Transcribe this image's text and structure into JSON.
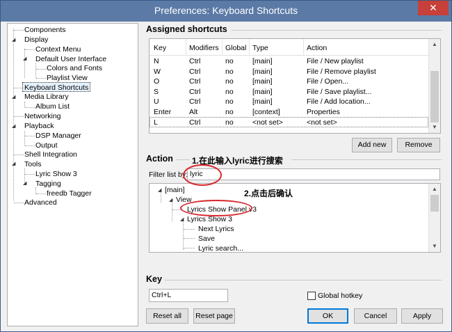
{
  "window": {
    "title": "Preferences: Keyboard Shortcuts",
    "close_glyph": "✕"
  },
  "sidebar": {
    "items": [
      {
        "label": "Components"
      },
      {
        "label": "Display"
      },
      {
        "label": "Context Menu"
      },
      {
        "label": "Default User Interface"
      },
      {
        "label": "Colors and Fonts"
      },
      {
        "label": "Playlist View"
      },
      {
        "label": "Keyboard Shortcuts"
      },
      {
        "label": "Media Library"
      },
      {
        "label": "Album List"
      },
      {
        "label": "Networking"
      },
      {
        "label": "Playback"
      },
      {
        "label": "DSP Manager"
      },
      {
        "label": "Output"
      },
      {
        "label": "Shell Integration"
      },
      {
        "label": "Tools"
      },
      {
        "label": "Lyric Show 3"
      },
      {
        "label": "Tagging"
      },
      {
        "label": "freedb Tagger"
      },
      {
        "label": "Advanced"
      }
    ],
    "selected": "Keyboard Shortcuts"
  },
  "assigned": {
    "title": "Assigned shortcuts",
    "columns": [
      "Key",
      "Modifiers",
      "Global",
      "Type",
      "Action"
    ],
    "rows": [
      [
        "N",
        "Ctrl",
        "no",
        "[main]",
        "File / New playlist"
      ],
      [
        "W",
        "Ctrl",
        "no",
        "[main]",
        "File / Remove playlist"
      ],
      [
        "O",
        "Ctrl",
        "no",
        "[main]",
        "File / Open..."
      ],
      [
        "S",
        "Ctrl",
        "no",
        "[main]",
        "File / Save playlist..."
      ],
      [
        "U",
        "Ctrl",
        "no",
        "[main]",
        "File / Add location..."
      ],
      [
        "Enter",
        "Alt",
        "no",
        "[context]",
        "Properties"
      ],
      [
        "L",
        "Ctrl",
        "no",
        "<not set>",
        "<not set>"
      ]
    ],
    "add_new_label": "Add new",
    "remove_label": "Remove"
  },
  "action": {
    "title": "Action",
    "filter_label": "Filter list by:",
    "filter_value": "lyric",
    "tree": [
      {
        "label": "[main]"
      },
      {
        "label": "View"
      },
      {
        "label": "Lyrics Show Panel v3"
      },
      {
        "label": "Lyrics Show 3"
      },
      {
        "label": "Next Lyrics"
      },
      {
        "label": "Save"
      },
      {
        "label": "Lyric search..."
      }
    ]
  },
  "key": {
    "title": "Key",
    "value": "Ctrl+L",
    "global_hotkey_label": "Global hotkey",
    "global_hotkey_checked": false
  },
  "footer": {
    "reset_all_label": "Reset all",
    "reset_page_label": "Reset page",
    "ok_label": "OK",
    "cancel_label": "Cancel",
    "apply_label": "Apply"
  },
  "annotations": {
    "step1": "1.在此输入lyric进行搜索",
    "step2": "2.点击后确认",
    "color": "#d9262a"
  }
}
